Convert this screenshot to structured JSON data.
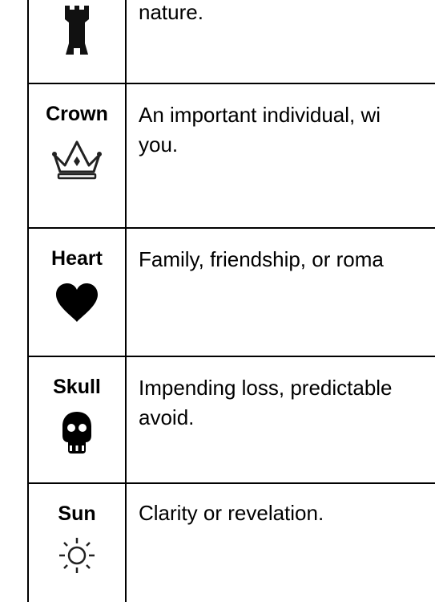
{
  "colors": {
    "border": "#000000",
    "text": "#000000",
    "background": "#ffffff"
  },
  "table": {
    "rows": [
      {
        "symbol": "",
        "icon": "tower-icon",
        "description_lines": [
          "nature."
        ]
      },
      {
        "symbol": "Crown",
        "icon": "crown-icon",
        "description_lines": [
          "An important individual, wi",
          "you."
        ]
      },
      {
        "symbol": "Heart",
        "icon": "heart-icon",
        "description_lines": [
          "Family, friendship, or roma"
        ]
      },
      {
        "symbol": "Skull",
        "icon": "skull-icon",
        "description_lines": [
          "Impending loss, predictable",
          "avoid."
        ]
      },
      {
        "symbol": "Sun",
        "icon": "sun-icon",
        "description_lines": [
          "Clarity or revelation."
        ]
      }
    ]
  }
}
